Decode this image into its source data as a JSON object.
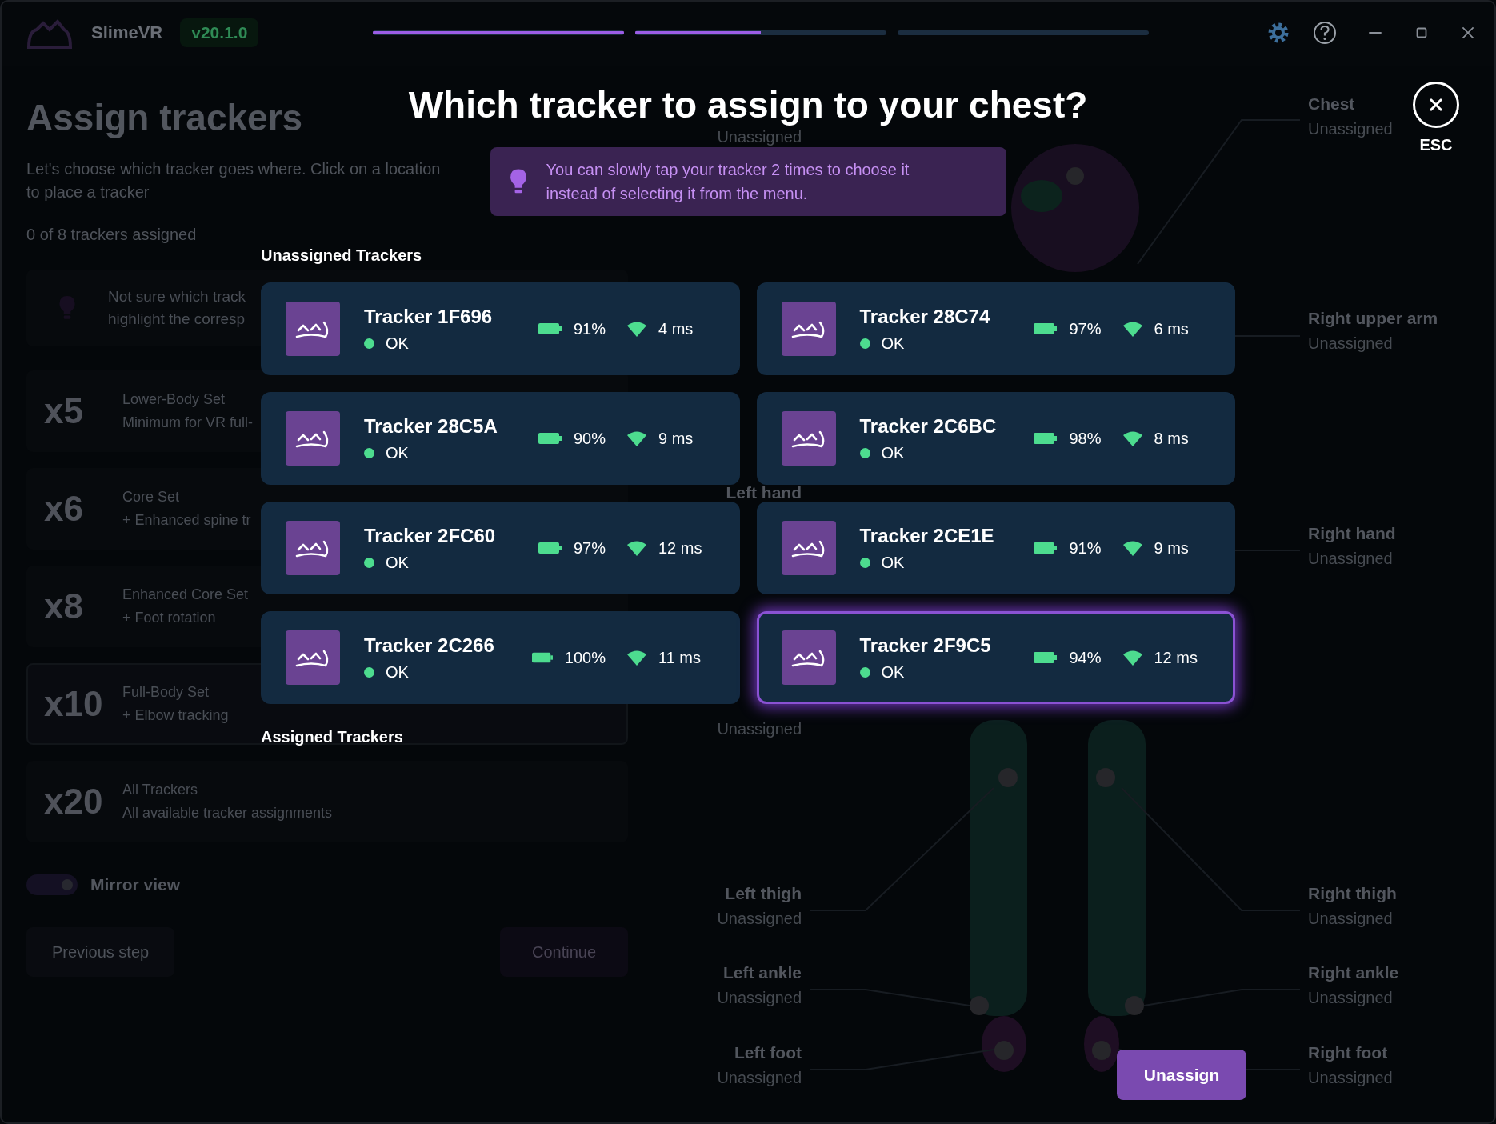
{
  "app": {
    "name": "SlimeVR",
    "version": "v20.1.0"
  },
  "progress": [
    {
      "level": 1
    },
    {
      "level": 0.5
    },
    {
      "level": 0
    }
  ],
  "page": {
    "title": "Assign trackers",
    "description": [
      "Let's choose which tracker goes where. Click on a location",
      "to place a tracker"
    ],
    "count": "0 of 8 trackers assigned",
    "hint_lines": [
      "Not sure which track",
      "highlight the corresp"
    ]
  },
  "sets": [
    {
      "count": "x5",
      "name": "Lower-Body Set",
      "detail": "Minimum for VR full-",
      "selected": false
    },
    {
      "count": "x6",
      "name": "Core Set",
      "detail": "+ Enhanced spine tr",
      "selected": false
    },
    {
      "count": "x8",
      "name": "Enhanced Core Set",
      "detail": "+ Foot rotation",
      "selected": false
    },
    {
      "count": "x10",
      "name": "Full-Body Set",
      "detail": "+ Elbow tracking",
      "selected": true
    },
    {
      "count": "x20",
      "name": "All Trackers",
      "detail": "All available tracker assignments",
      "selected": false
    }
  ],
  "mirror_view": {
    "label": "Mirror view",
    "on": true
  },
  "previous_button": "Previous step",
  "continue_button": {
    "label": "Continue",
    "disabled": true
  },
  "body_labels": {
    "left": [
      {
        "status": "Unassigned"
      },
      {
        "name": "Left hand"
      },
      {
        "status": "Unassigned"
      },
      {
        "name": "Left thigh",
        "status": "Unassigned"
      },
      {
        "name": "Left ankle",
        "status": "Unassigned"
      },
      {
        "name": "Left foot",
        "status": "Unassigned"
      }
    ],
    "right": [
      {
        "name": "Chest",
        "status": "Unassigned"
      },
      {
        "name": "Right upper arm",
        "status": "Unassigned"
      },
      {
        "name": "Right hand",
        "status": "Unassigned"
      },
      {
        "name": "Right thigh",
        "status": "Unassigned"
      },
      {
        "name": "Right ankle",
        "status": "Unassigned"
      },
      {
        "name": "Right foot",
        "status": "Unassigned"
      }
    ]
  },
  "modal": {
    "title": "Which tracker to assign to your chest?",
    "tip": "You can slowly tap your tracker 2 times to choose it instead of selecting it from the menu.",
    "close_hint": "ESC",
    "unassigned_heading": "Unassigned Trackers",
    "assigned_heading": "Assigned Trackers",
    "unassign_button": "Unassign",
    "trackers": [
      {
        "name": "Tracker 1F696",
        "status": "OK",
        "battery": "91%",
        "latency": "4 ms",
        "selected": false
      },
      {
        "name": "Tracker 28C74",
        "status": "OK",
        "battery": "97%",
        "latency": "6 ms",
        "selected": false
      },
      {
        "name": "Tracker 28C5A",
        "status": "OK",
        "battery": "90%",
        "latency": "9 ms",
        "selected": false
      },
      {
        "name": "Tracker 2C6BC",
        "status": "OK",
        "battery": "98%",
        "latency": "8 ms",
        "selected": false
      },
      {
        "name": "Tracker 2FC60",
        "status": "OK",
        "battery": "97%",
        "latency": "12 ms",
        "selected": false
      },
      {
        "name": "Tracker 2CE1E",
        "status": "OK",
        "battery": "91%",
        "latency": "9 ms",
        "selected": false
      },
      {
        "name": "Tracker 2C266",
        "status": "OK",
        "battery": "100%",
        "latency": "11 ms",
        "selected": false
      },
      {
        "name": "Tracker 2F9C5",
        "status": "OK",
        "battery": "94%",
        "latency": "12 ms",
        "selected": true
      }
    ]
  }
}
